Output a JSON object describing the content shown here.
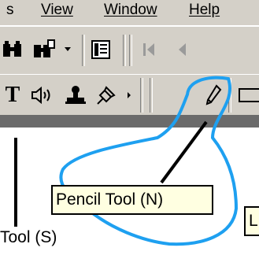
{
  "menu": {
    "items": [
      "s",
      "View",
      "Window",
      "Help"
    ]
  },
  "toolbar1": {
    "icons": [
      "binoculars-icon",
      "find-replace-icon",
      "dropdown-arrow-icon",
      "page-view-icon",
      "first-page-icon",
      "previous-page-icon"
    ]
  },
  "toolbar2": {
    "text_tool_glyph": "T",
    "icons": [
      "text-tool-icon",
      "sound-icon",
      "stamp-icon",
      "pushpin-icon",
      "dropdown-arrow-icon",
      "pencil-tool-icon",
      "rectangle-tool-icon"
    ]
  },
  "tooltip": {
    "label": "Pencil Tool (N)",
    "partial_label": "L"
  },
  "left_label": "Tool (S)",
  "colors": {
    "highlight": "#1ea0f0",
    "toolbar": "#d4d0c8",
    "tooltip_bg": "#ffffe1"
  }
}
